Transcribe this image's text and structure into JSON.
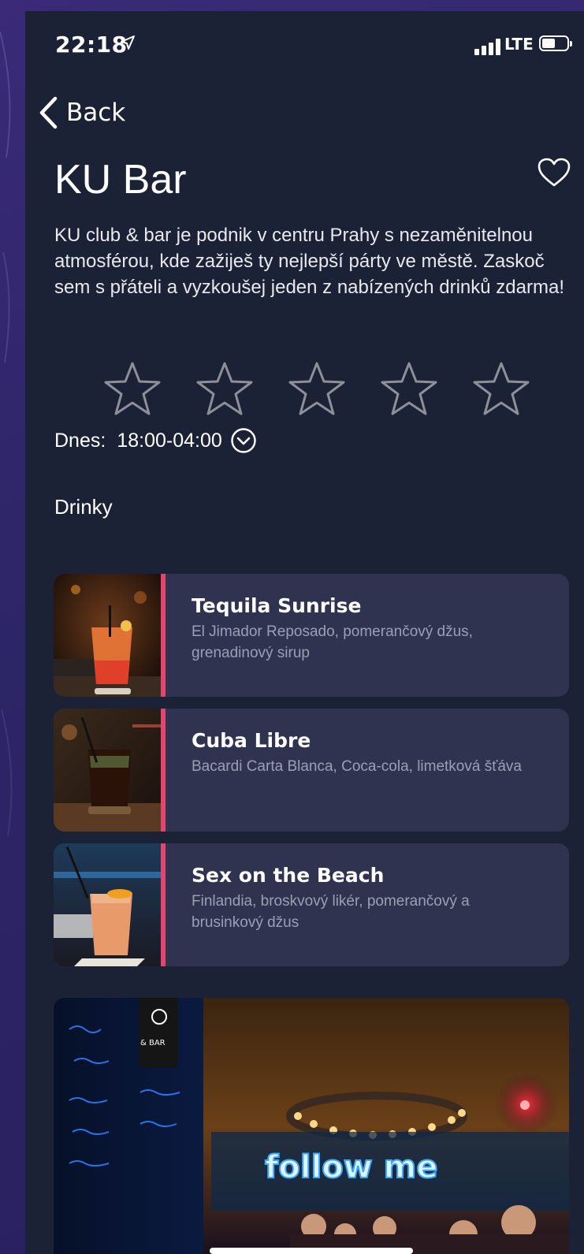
{
  "status_bar": {
    "time": "22:18",
    "network": "LTE"
  },
  "nav": {
    "back_label": "Back"
  },
  "venue": {
    "title": "KU Bar",
    "description": "KU club & bar je podnik v centru Prahy s nezaměnitelnou atmosférou, kde zažiješ ty nejlepší párty ve městě. Zaskoč sem s přáteli a vyzkoušej jeden z nabízených drinků zdarma!",
    "rating": {
      "value": 0,
      "max": 5
    },
    "hours": {
      "label": "Dnes:",
      "value": "18:00-04:00"
    }
  },
  "drinks_section": {
    "title": "Drinky",
    "items": [
      {
        "name": "Tequila Sunrise",
        "ingredients": "El Jimador Reposado, pomerančový džus, grenadinový sirup"
      },
      {
        "name": "Cuba Libre",
        "ingredients": "Bacardi Carta Blanca, Coca-cola, limetková šťáva"
      },
      {
        "name": "Sex on the Beach",
        "ingredients": "Finlandia, broskvový likér, pomerančový a brusinkový džus"
      }
    ]
  },
  "gallery": {
    "neon_text": "follow me",
    "sign_text": "& BAR"
  },
  "colors": {
    "background": "#1b2235",
    "card": "#2f3350",
    "accent": "#e0466f",
    "muted_text": "#9aa0b3"
  },
  "icons": [
    "location-arrow-icon",
    "signal-icon",
    "battery-icon",
    "chevron-left-icon",
    "heart-icon",
    "star-icon",
    "chevron-down-circle-icon"
  ]
}
